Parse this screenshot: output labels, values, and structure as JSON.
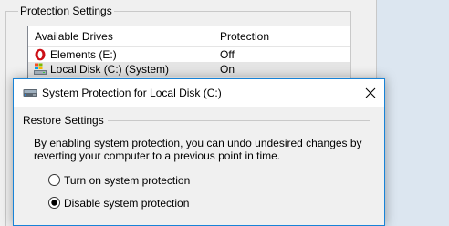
{
  "background_window": {
    "group_title": "Protection Settings",
    "columns": {
      "drive": "Available Drives",
      "protection": "Protection"
    },
    "rows": [
      {
        "name": "Elements (E:)",
        "protection": "Off",
        "icon": "opera-drive-icon",
        "icon_color": "#cc0f16"
      },
      {
        "name": "Local Disk (C:) (System)",
        "protection": "On",
        "icon": "system-disk-icon",
        "icon_color": "#2a7fd4"
      }
    ]
  },
  "dialog": {
    "title": "System Protection for Local Disk (C:)",
    "restore_group_title": "Restore Settings",
    "description": "By enabling system protection, you can undo undesired changes by reverting your computer to a previous point in time.",
    "options": [
      {
        "label": "Turn on system protection",
        "selected": false
      },
      {
        "label": "Disable system protection",
        "selected": true
      }
    ],
    "accent_color": "#1883d7"
  }
}
